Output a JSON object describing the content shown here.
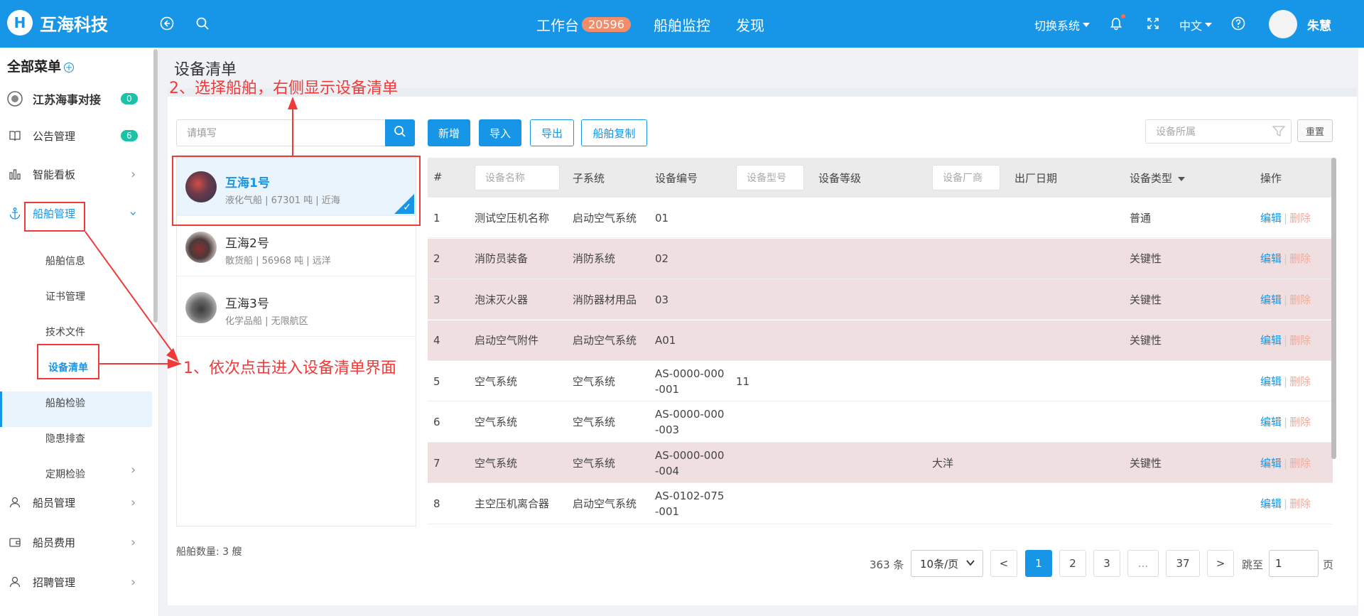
{
  "header": {
    "logo_glyph": "H",
    "brand": "互海科技",
    "nav": [
      {
        "label": "工作台",
        "badge": "20596"
      },
      {
        "label": "船舶监控"
      },
      {
        "label": "发现"
      }
    ],
    "switch_system": "切换系统",
    "language": "中文",
    "user_name": "朱慧",
    "accent_color": "#1796e8"
  },
  "sidebar": {
    "title": "全部菜单",
    "items": [
      {
        "label": "江苏海事对接",
        "badge": "0",
        "icon": "emblem-icon"
      },
      {
        "label": "公告管理",
        "badge": "6",
        "icon": "book-icon"
      },
      {
        "label": "智能看板",
        "icon": "bar-chart-icon"
      },
      {
        "label": "船舶管理",
        "icon": "anchor-icon"
      },
      {
        "label": "船员管理",
        "icon": "user-icon"
      },
      {
        "label": "船员费用",
        "icon": "wallet-icon"
      },
      {
        "label": "招聘管理",
        "icon": "user-icon"
      }
    ],
    "sub_items": [
      "船舶信息",
      "证书管理",
      "技术文件",
      "设备清单",
      "船舶检验",
      "隐患排查",
      "定期检验"
    ]
  },
  "page": {
    "title": "设备清单"
  },
  "ship_list": {
    "search_placeholder": "请填写",
    "ships": [
      {
        "name": "互海1号",
        "sub": "液化气船 | 67301 吨 | 近海"
      },
      {
        "name": "互海2号",
        "sub": "散货船 | 56968 吨 | 远洋"
      },
      {
        "name": "互海3号",
        "sub": "化学品船 | 无限航区"
      }
    ],
    "count_label": "船舶数量: 3 艘"
  },
  "toolbar": {
    "add": "新增",
    "import": "导入",
    "export": "导出",
    "copy": "船舶复制",
    "filter_placeholder": "设备所属",
    "reset": "重置"
  },
  "table": {
    "headers": {
      "index": "#",
      "name_placeholder": "设备名称",
      "subsystem": "子系统",
      "code": "设备编号",
      "model_placeholder": "设备型号",
      "grade": "设备等级",
      "maker_placeholder": "设备厂商",
      "date": "出厂日期",
      "type": "设备类型",
      "ops": "操作"
    },
    "rows": [
      {
        "idx": "1",
        "name": "测试空压机名称",
        "sub": "启动空气系统",
        "code": "01",
        "model": "",
        "maker": "",
        "type": "普通",
        "key": false
      },
      {
        "idx": "2",
        "name": "消防员装备",
        "sub": "消防系统",
        "code": "02",
        "model": "",
        "maker": "",
        "type": "关键性",
        "key": true
      },
      {
        "idx": "3",
        "name": "泡沫灭火器",
        "sub": "消防器材用品",
        "code": "03",
        "model": "",
        "maker": "",
        "type": "关键性",
        "key": true
      },
      {
        "idx": "4",
        "name": "启动空气附件",
        "sub": "启动空气系统",
        "code": "A01",
        "model": "",
        "maker": "",
        "type": "关键性",
        "key": true
      },
      {
        "idx": "5",
        "name": "空气系统",
        "sub": "空气系统",
        "code": "AS-0000-000-001",
        "model": "11",
        "maker": "",
        "type": "",
        "key": false
      },
      {
        "idx": "6",
        "name": "空气系统",
        "sub": "空气系统",
        "code": "AS-0000-000-003",
        "model": "",
        "maker": "",
        "type": "",
        "key": false
      },
      {
        "idx": "7",
        "name": "空气系统",
        "sub": "空气系统",
        "code": "AS-0000-000-004",
        "model": "",
        "maker": "大洋",
        "type": "关键性",
        "key": true
      },
      {
        "idx": "8",
        "name": "主空压机离合器",
        "sub": "启动空气系统",
        "code": "AS-0102-075-001",
        "model": "",
        "maker": "",
        "type": "",
        "key": false
      }
    ],
    "edit_label": "编辑",
    "delete_label": "删除",
    "key_row_color": "#f0dfe0"
  },
  "pagination": {
    "total": "363 条",
    "page_size": "10条/页",
    "prev": "<",
    "pages": [
      "1",
      "2",
      "3",
      "...",
      "37"
    ],
    "next": ">",
    "jump_label": "跳至",
    "jump_value": "1",
    "page_suffix": "页"
  },
  "annotations": {
    "step1": "1、依次点击进入设备清单界面",
    "step2": "2、选择船舶，右侧显示设备清单",
    "color": "#f03a3a"
  }
}
